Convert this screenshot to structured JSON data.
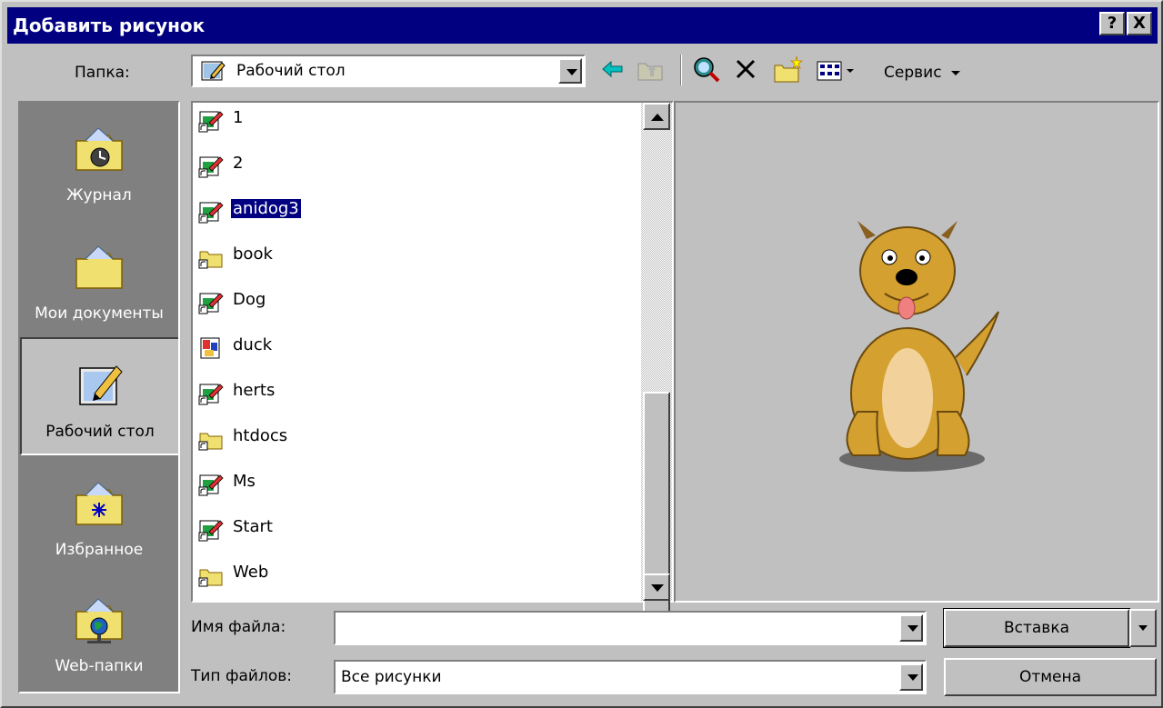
{
  "window": {
    "title": "Добавить рисунок",
    "help_btn": "?",
    "close_btn": "X"
  },
  "folder": {
    "label": "Папка:",
    "value": "Рабочий стол"
  },
  "toolbar": {
    "tools_menu": "Сервис"
  },
  "places": [
    {
      "label": "Журнал",
      "icon": "history-folder-icon"
    },
    {
      "label": "Мои документы",
      "icon": "my-documents-folder-icon"
    },
    {
      "label": "Рабочий стол",
      "icon": "desktop-icon"
    },
    {
      "label": "Избранное",
      "icon": "favorites-folder-icon"
    },
    {
      "label": "Web-папки",
      "icon": "web-folders-icon"
    }
  ],
  "files": [
    {
      "name": "1",
      "type": "shortcut"
    },
    {
      "name": "2",
      "type": "shortcut"
    },
    {
      "name": "anidog3",
      "type": "shortcut",
      "selected": true
    },
    {
      "name": "book",
      "type": "folder-shortcut"
    },
    {
      "name": "Dog",
      "type": "shortcut"
    },
    {
      "name": "duck",
      "type": "image"
    },
    {
      "name": "herts",
      "type": "shortcut"
    },
    {
      "name": "htdocs",
      "type": "folder-shortcut"
    },
    {
      "name": "Ms",
      "type": "shortcut"
    },
    {
      "name": "Start",
      "type": "shortcut"
    },
    {
      "name": "Web",
      "type": "folder-shortcut"
    }
  ],
  "filename": {
    "label": "Имя файла:",
    "value": ""
  },
  "filetype": {
    "label": "Тип файлов:",
    "value": "Все рисунки"
  },
  "buttons": {
    "insert": "Вставка",
    "cancel": "Отмена"
  },
  "colors": {
    "title_bg": "#000080",
    "dialog_bg": "#c0c0c0",
    "selection": "#000080"
  }
}
